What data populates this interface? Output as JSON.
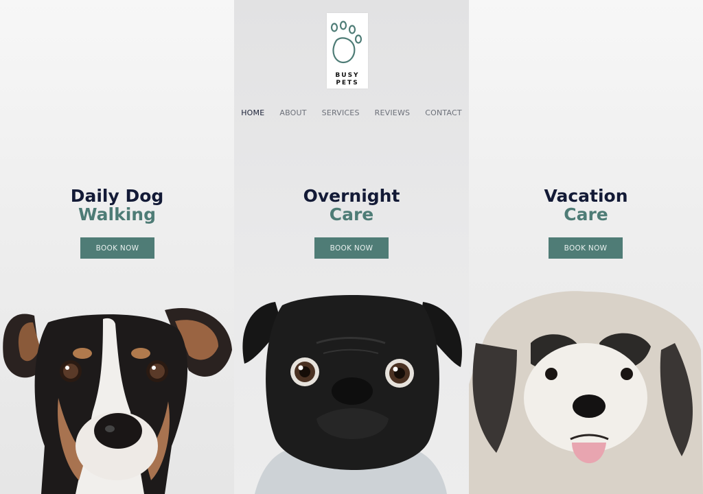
{
  "brand": {
    "logo_text_line1": "BUSY",
    "logo_text_line2": "PETS",
    "accent": "#4f7c76",
    "heading_color": "#131a36"
  },
  "nav": {
    "items": [
      {
        "label": "HOME",
        "active": true
      },
      {
        "label": "ABOUT"
      },
      {
        "label": "SERVICES"
      },
      {
        "label": "REVIEWS"
      },
      {
        "label": "CONTACT"
      }
    ]
  },
  "panels": [
    {
      "line1": "Daily Dog",
      "line2": "Walking",
      "button": "BOOK NOW",
      "image": "jack-russell-terrier"
    },
    {
      "line1": "Overnight",
      "line2": "Care",
      "button": "BOOK NOW",
      "image": "black-pug"
    },
    {
      "line1": "Vacation",
      "line2": "Care",
      "button": "BOOK NOW",
      "image": "shih-tzu"
    }
  ]
}
